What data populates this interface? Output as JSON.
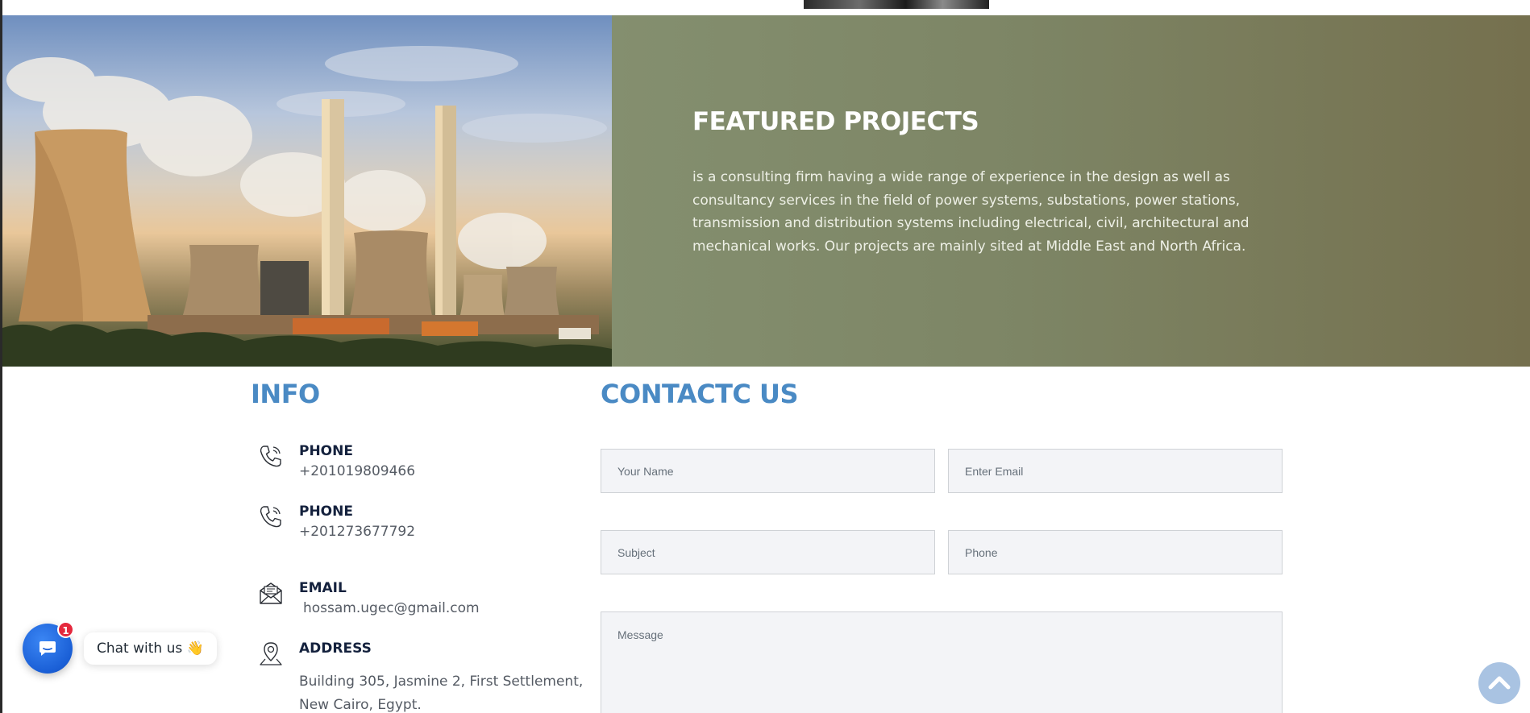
{
  "featured": {
    "title": "FEATURED PROJECTS",
    "description": "is a consulting firm having a wide range of experience in the design as well as consultancy services in the field of power systems, substations, power stations, transmission and distribution systems including electrical, civil, architectural and mechanical works. Our projects are mainly sited at Middle East and North Africa."
  },
  "info": {
    "title": "INFO",
    "items": [
      {
        "label": "PHONE",
        "value": "+201019809466",
        "icon": "phone-icon"
      },
      {
        "label": "PHONE",
        "value": "+201273677792",
        "icon": "phone-icon"
      },
      {
        "label": "EMAIL",
        "value": "hossam.ugec@gmail.com",
        "icon": "envelope-icon"
      },
      {
        "label": "ADDRESS",
        "value_line1": "Building 305, Jasmine 2, First Settlement,",
        "value_line2": "New Cairo, Egypt.",
        "icon": "map-pin-icon"
      }
    ]
  },
  "contact": {
    "title": "CONTACTC US",
    "name_placeholder": "Your Name",
    "email_placeholder": "Enter Email",
    "subject_placeholder": "Subject",
    "phone_placeholder": "Phone",
    "message_placeholder": "Message"
  },
  "chat": {
    "label": "Chat with us 👋",
    "badge_count": "1",
    "icon": "chat-bubble-icon"
  },
  "scroll_top": {
    "icon": "chevron-up-icon"
  },
  "colors": {
    "accent_blue": "#4a8ac4",
    "panel_olive": "#7d8565",
    "chat_blue": "#1a5fd6",
    "badge_red": "#e5283d"
  }
}
